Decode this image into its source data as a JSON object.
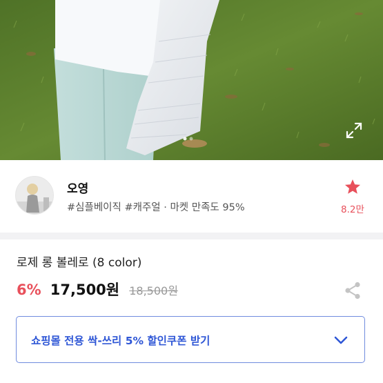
{
  "product_image": {
    "alt_subject": "product-photo"
  },
  "shop": {
    "name": "오영",
    "tags": "#심플베이직 #캐주얼 · 마켓 만족도 95%",
    "favorite_count": "8.2만"
  },
  "product": {
    "name": "로제 롱 볼레로 (8 color)",
    "discount": "6%",
    "price": "17,500원",
    "original_price": "18,500원"
  },
  "coupon": {
    "label": "쇼핑몰 전용 싹-쓰리 5% 할인쿠폰 받기"
  },
  "colors": {
    "accent_red": "#e8505b",
    "accent_blue": "#2f57d6",
    "coupon_border": "#6f8bde"
  },
  "icons": {
    "expand": "expand-icon",
    "favorite": "star-icon",
    "share": "share-icon",
    "chevron": "chevron-down-icon"
  }
}
